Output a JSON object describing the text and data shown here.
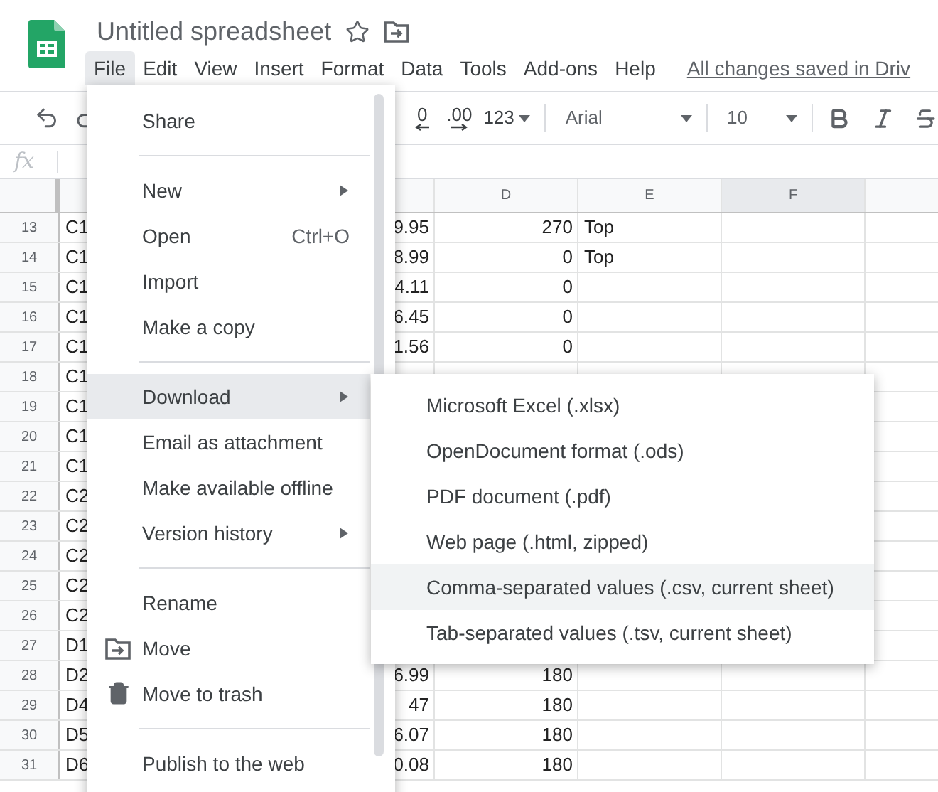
{
  "app": {
    "title": "Untitled spreadsheet",
    "save_status": "All changes saved in Driv"
  },
  "menu_bar": [
    {
      "label": "File",
      "selected": true
    },
    {
      "label": "Edit",
      "selected": false
    },
    {
      "label": "View",
      "selected": false
    },
    {
      "label": "Insert",
      "selected": false
    },
    {
      "label": "Format",
      "selected": false
    },
    {
      "label": "Data",
      "selected": false
    },
    {
      "label": "Tools",
      "selected": false
    },
    {
      "label": "Add-ons",
      "selected": false
    },
    {
      "label": "Help",
      "selected": false
    }
  ],
  "toolbar": {
    "decimal_decrease": "0",
    "decimal_increase": ".00",
    "number_format": "123",
    "font": "Arial",
    "font_size": "10"
  },
  "formula_bar": {
    "label": "fx"
  },
  "columns": [
    {
      "label": "D",
      "selected": false
    },
    {
      "label": "E",
      "selected": false
    },
    {
      "label": "F",
      "selected": true
    }
  ],
  "rows": [
    {
      "number": "13",
      "col_b": "C1",
      "col_c": "9.95",
      "col_d": "270",
      "col_e": "Top"
    },
    {
      "number": "14",
      "col_b": "C1",
      "col_c": "8.99",
      "col_d": "0",
      "col_e": "Top"
    },
    {
      "number": "15",
      "col_b": "C1",
      "col_c": "4.11",
      "col_d": "0"
    },
    {
      "number": "16",
      "col_b": "C1",
      "col_c": "6.45",
      "col_d": "0"
    },
    {
      "number": "17",
      "col_b": "C1",
      "col_c": "1.56",
      "col_d": "0"
    },
    {
      "number": "18",
      "col_b": "C1"
    },
    {
      "number": "19",
      "col_b": "C1"
    },
    {
      "number": "20",
      "col_b": "C1"
    },
    {
      "number": "21",
      "col_b": "C1"
    },
    {
      "number": "22",
      "col_b": "C2"
    },
    {
      "number": "23",
      "col_b": "C2"
    },
    {
      "number": "24",
      "col_b": "C2"
    },
    {
      "number": "25",
      "col_b": "C2"
    },
    {
      "number": "26",
      "col_b": "C2"
    },
    {
      "number": "27",
      "col_b": "D1"
    },
    {
      "number": "28",
      "col_b": "D2",
      "col_c": "6.99",
      "col_d": "180"
    },
    {
      "number": "29",
      "col_b": "D4",
      "col_c": "47",
      "col_d": "180"
    },
    {
      "number": "30",
      "col_b": "D5",
      "col_c": "6.07",
      "col_d": "180"
    },
    {
      "number": "31",
      "col_b": "D6",
      "col_c": "0.08",
      "col_d": "180"
    }
  ],
  "file_menu": [
    {
      "kind": "action",
      "label": "Share",
      "selected": false
    },
    {
      "kind": "divider"
    },
    {
      "kind": "submenu",
      "label": "New",
      "selected": false
    },
    {
      "kind": "action",
      "label": "Open",
      "shortcut": "Ctrl+O",
      "selected": false
    },
    {
      "kind": "action",
      "label": "Import",
      "selected": false
    },
    {
      "kind": "action",
      "label": "Make a copy",
      "selected": false
    },
    {
      "kind": "divider"
    },
    {
      "kind": "submenu",
      "label": "Download",
      "selected": true
    },
    {
      "kind": "action",
      "label": "Email as attachment",
      "selected": false
    },
    {
      "kind": "action",
      "label": "Make available offline",
      "selected": false
    },
    {
      "kind": "submenu",
      "label": "Version history",
      "selected": false
    },
    {
      "kind": "divider"
    },
    {
      "kind": "action",
      "label": "Rename",
      "selected": false
    },
    {
      "kind": "folder",
      "label": "Move",
      "selected": false
    },
    {
      "kind": "trash",
      "label": "Move to trash",
      "selected": false
    },
    {
      "kind": "divider"
    },
    {
      "kind": "action",
      "label": "Publish to the web",
      "selected": false
    }
  ],
  "download_menu": [
    {
      "label": "Microsoft Excel (.xlsx)",
      "selected": false
    },
    {
      "label": "OpenDocument format (.ods)",
      "selected": false
    },
    {
      "label": "PDF document (.pdf)",
      "selected": false
    },
    {
      "label": "Web page (.html, zipped)",
      "selected": false
    },
    {
      "label": "Comma-separated values (.csv, current sheet)",
      "selected": true
    },
    {
      "label": "Tab-separated values (.tsv, current sheet)",
      "selected": false
    }
  ]
}
